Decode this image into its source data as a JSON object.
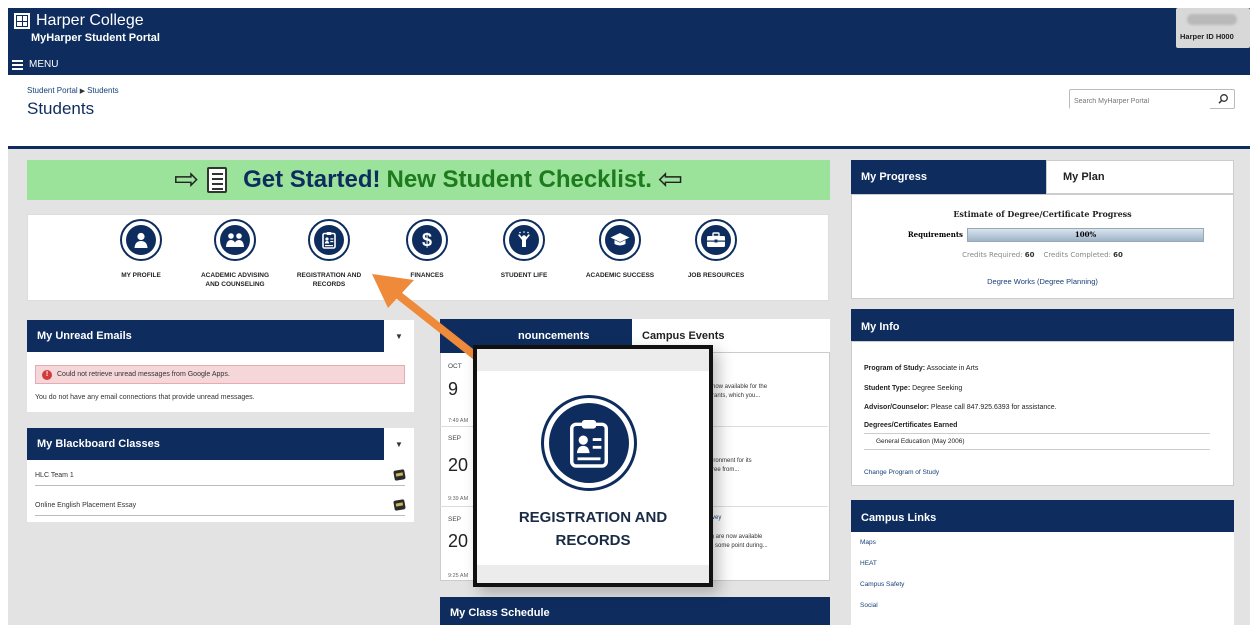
{
  "header": {
    "college": "Harper College",
    "portal": "MyHarper Student Portal",
    "menu": "MENU",
    "user_id": "Harper ID H000"
  },
  "breadcrumb": {
    "root": "Student Portal",
    "current": "Students"
  },
  "page_title": "Students",
  "search": {
    "placeholder": "Search MyHarper Portal"
  },
  "checklist": {
    "part1": "Get Started!",
    "part2": "New Student Checklist."
  },
  "quick_links": [
    {
      "label": "MY PROFILE",
      "icon": "user-icon"
    },
    {
      "label": "ACADEMIC ADVISING AND COUNSELING",
      "icon": "people-icon"
    },
    {
      "label": "REGISTRATION AND RECORDS",
      "icon": "clipboard-id-icon"
    },
    {
      "label": "FINANCES",
      "icon": "dollar-icon"
    },
    {
      "label": "STUDENT LIFE",
      "icon": "person-celebrate-icon"
    },
    {
      "label": "ACADEMIC SUCCESS",
      "icon": "graduation-cap-icon"
    },
    {
      "label": "JOB RESOURCES",
      "icon": "briefcase-icon"
    }
  ],
  "emails": {
    "title": "My Unread Emails",
    "alert": "Could not retrieve unread messages from Google Apps.",
    "message": "You do not have any email connections that provide unread messages."
  },
  "blackboard": {
    "title": "My Blackboard Classes",
    "classes": [
      "HLC Team 1",
      "Online English Placement Essay"
    ]
  },
  "announcements": {
    "tab_active_partial": "nouncements",
    "tab_events": "Campus Events",
    "items": [
      {
        "month": "OCT",
        "day": "9",
        "time": "7:49 AM",
        "text1": "now available for the",
        "text2": "rants, which you..."
      },
      {
        "month": "SEP",
        "day": "20",
        "time": "9:39 AM",
        "text1": "ironment for its",
        "text2": "ree from..."
      },
      {
        "month": "SEP",
        "day": "20",
        "time": "9:25 AM",
        "link": "vey",
        "text1": ") are now available",
        "text2": "l some point during..."
      }
    ]
  },
  "zoom": {
    "label_line1": "REGISTRATION AND",
    "label_line2": "RECORDS"
  },
  "class_schedule": {
    "title": "My Class Schedule"
  },
  "progress": {
    "tab_progress": "My Progress",
    "tab_plan": "My Plan",
    "heading": "Estimate of Degree/Certificate Progress",
    "requirements_label": "Requirements",
    "percent": 100,
    "percent_text": "100%",
    "credits_required_label": "Credits Required:",
    "credits_required": "60",
    "credits_completed_label": "Credits Completed:",
    "credits_completed": "60",
    "link": "Degree Works (Degree Planning)"
  },
  "info": {
    "title": "My Info",
    "program_label": "Program of Study:",
    "program": "Associate in Arts",
    "student_type_label": "Student Type:",
    "student_type": "Degree Seeking",
    "advisor_label": "Advisor/Counselor:",
    "advisor": "Please call 847.925.6393 for assistance.",
    "degrees_label": "Degrees/Certificates Earned",
    "degree": "General Education (May 2006)",
    "change_link": "Change Program of Study"
  },
  "campus_links": {
    "title": "Campus Links",
    "items": [
      "Maps",
      "HEAT",
      "Campus Safety",
      "Social"
    ]
  },
  "colors": {
    "navy": "#0e2d5e",
    "green_banner": "#9be29a",
    "accent_arrow": "#ee8a3a"
  }
}
